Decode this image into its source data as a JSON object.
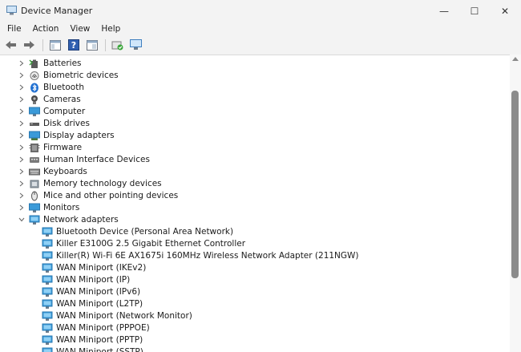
{
  "window": {
    "title": "Device Manager",
    "minimize_glyph": "—",
    "maximize_glyph": "☐",
    "close_glyph": "✕"
  },
  "menu": [
    "File",
    "Action",
    "View",
    "Help"
  ],
  "toolbar": {
    "buttons": [
      "back-arrow-icon",
      "forward-arrow-icon",
      "properties-icon",
      "help-icon",
      "view-icon",
      "update-driver-icon",
      "scan-hardware-icon"
    ]
  },
  "tree": {
    "categories": [
      {
        "label": "Batteries",
        "icon": "battery-icon",
        "expanded": false
      },
      {
        "label": "Biometric devices",
        "icon": "biometric-icon",
        "expanded": false
      },
      {
        "label": "Bluetooth",
        "icon": "bluetooth-icon",
        "expanded": false
      },
      {
        "label": "Cameras",
        "icon": "camera-icon",
        "expanded": false
      },
      {
        "label": "Computer",
        "icon": "computer-icon",
        "expanded": false
      },
      {
        "label": "Disk drives",
        "icon": "disk-drive-icon",
        "expanded": false
      },
      {
        "label": "Display adapters",
        "icon": "display-adapter-icon",
        "expanded": false
      },
      {
        "label": "Firmware",
        "icon": "firmware-icon",
        "expanded": false
      },
      {
        "label": "Human Interface Devices",
        "icon": "hid-icon",
        "expanded": false
      },
      {
        "label": "Keyboards",
        "icon": "keyboard-icon",
        "expanded": false
      },
      {
        "label": "Memory technology devices",
        "icon": "memory-icon",
        "expanded": false
      },
      {
        "label": "Mice and other pointing devices",
        "icon": "mouse-icon",
        "expanded": false
      },
      {
        "label": "Monitors",
        "icon": "monitor-icon",
        "expanded": false
      },
      {
        "label": "Network adapters",
        "icon": "network-adapter-icon",
        "expanded": true
      }
    ],
    "network_children": [
      "Bluetooth Device (Personal Area Network)",
      "Killer E3100G 2.5 Gigabit Ethernet Controller",
      "Killer(R) Wi-Fi 6E AX1675i 160MHz Wireless Network Adapter (211NGW)",
      "WAN Miniport (IKEv2)",
      "WAN Miniport (IP)",
      "WAN Miniport (IPv6)",
      "WAN Miniport (L2TP)",
      "WAN Miniport (Network Monitor)",
      "WAN Miniport (PPPOE)",
      "WAN Miniport (PPTP)",
      "WAN Miniport (SSTP)"
    ]
  },
  "colors": {
    "monitor_blue": "#3a9ad9",
    "chevron": "#6b6b6b"
  }
}
